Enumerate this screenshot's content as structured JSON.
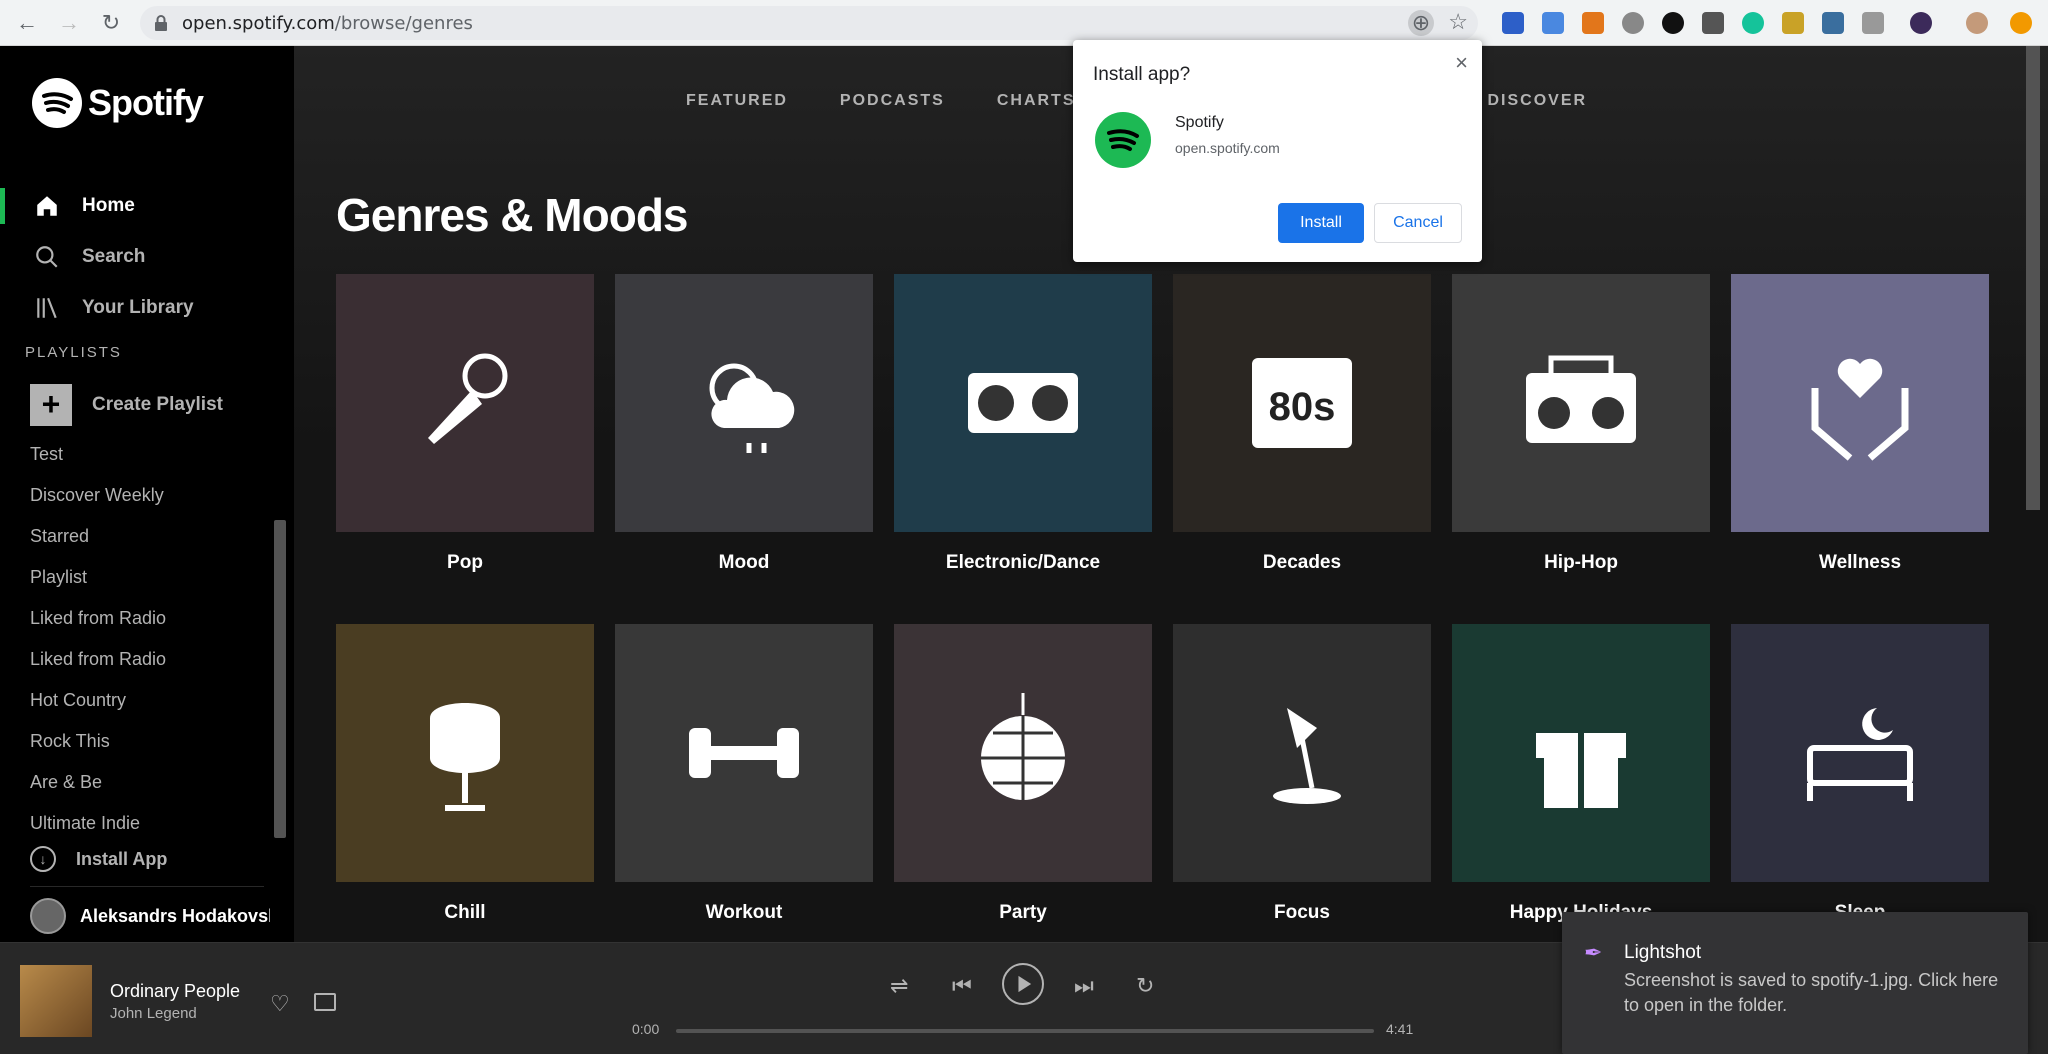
{
  "browser": {
    "url_host": "open.spotify.com",
    "url_path": "/browse/genres"
  },
  "sidebar": {
    "brand": "Spotify",
    "nav": [
      {
        "label": "Home"
      },
      {
        "label": "Search"
      },
      {
        "label": "Your Library"
      }
    ],
    "playlists_heading": "PLAYLISTS",
    "create_playlist": "Create Playlist",
    "playlists": [
      "Test",
      "Discover Weekly",
      "Starred",
      "Playlist",
      "Liked from Radio",
      "Liked from Radio",
      "Hot Country",
      "Rock This",
      "Are & Be",
      "Ultimate Indie"
    ],
    "install_app": "Install App",
    "user_name": "Aleksandrs Hodakovski"
  },
  "tabs": [
    "FEATURED",
    "PODCASTS",
    "CHARTS",
    "",
    "DISCOVER"
  ],
  "page_title": "Genres & Moods",
  "genres": [
    {
      "name": "Pop",
      "icon": "microphone-icon",
      "bg": "#3a2e33"
    },
    {
      "name": "Mood",
      "icon": "sun-cloud-icon",
      "bg": "#3a3a3e"
    },
    {
      "name": "Electronic/Dance",
      "icon": "turntable-icon",
      "bg": "#1f3c4a"
    },
    {
      "name": "Decades",
      "icon": "calendar-80s-icon",
      "bg": "#2a2622"
    },
    {
      "name": "Hip-Hop",
      "icon": "boombox-icon",
      "bg": "#3a3a3a"
    },
    {
      "name": "Wellness",
      "icon": "heart-hands-icon",
      "bg": "#6c6a8c"
    },
    {
      "name": "Chill",
      "icon": "egg-chair-icon",
      "bg": "#4a3d22"
    },
    {
      "name": "Workout",
      "icon": "dumbbell-icon",
      "bg": "#383838"
    },
    {
      "name": "Party",
      "icon": "disco-ball-icon",
      "bg": "#3b3336"
    },
    {
      "name": "Focus",
      "icon": "lamp-icon",
      "bg": "#2e2e2e"
    },
    {
      "name": "Happy Holidays",
      "icon": "gift-icon",
      "bg": "#1a3a32"
    },
    {
      "name": "Sleep",
      "icon": "bed-icon",
      "bg": "#2e2f3e"
    }
  ],
  "player": {
    "track": "Ordinary People",
    "artist": "John Legend",
    "elapsed": "0:00",
    "duration": "4:41",
    "progress": 0
  },
  "install_dialog": {
    "heading": "Install app?",
    "app_name": "Spotify",
    "app_url": "open.spotify.com",
    "install": "Install",
    "cancel": "Cancel"
  },
  "toast": {
    "title": "Lightshot",
    "body": "Screenshot is saved to spotify-1.jpg. Click here to open in the folder."
  }
}
